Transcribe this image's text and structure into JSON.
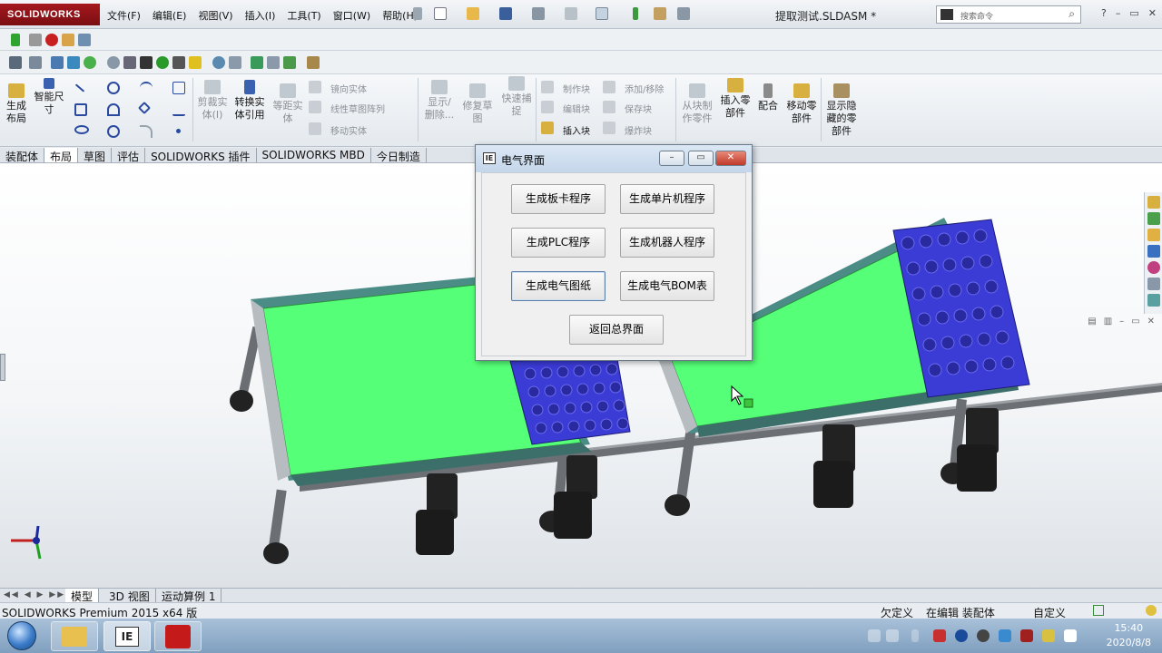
{
  "app": {
    "logo": "SOLIDWORKS",
    "document_title": "提取测试.SLDASM *",
    "menus": [
      "文件(F)",
      "编辑(E)",
      "视图(V)",
      "插入(I)",
      "工具(T)",
      "窗口(W)",
      "帮助(H)"
    ],
    "search_placeholder": "搜索命令",
    "window_controls": [
      "?",
      "–",
      "▭",
      "✕"
    ]
  },
  "ribbon": {
    "generate_layout": "生成\n布局",
    "smart_dimension": "智能尺\n寸",
    "trim_entities": "剪裁实\n体(I)",
    "convert_entities": "转换实\n体引用",
    "offset_entities": "等距实\n体",
    "mirror_entities": "镜向实体",
    "linear_pattern": "线性草图阵列",
    "move_entities": "移动实体",
    "show_delete": "显示/\n删除...",
    "repair_sketch": "修复草\n图",
    "quick_snap": "快速捕\n捉",
    "make_block": "制作块",
    "edit_block": "编辑块",
    "insert_block": "插入块",
    "add_remove": "添加/移除",
    "save_block": "保存块",
    "explode_block": "爆炸块",
    "make_part_from_block": "从块制\n作零件",
    "insert_component": "插入零\n部件",
    "mate": "配合",
    "move_component": "移动零\n部件",
    "show_hidden": "显示隐\n藏的零\n部件"
  },
  "tabs": [
    {
      "label": "装配体",
      "active": false
    },
    {
      "label": "布局",
      "active": true
    },
    {
      "label": "草图",
      "active": false
    },
    {
      "label": "评估",
      "active": false
    },
    {
      "label": "SOLIDWORKS 插件",
      "active": false
    },
    {
      "label": "SOLIDWORKS MBD",
      "active": false
    },
    {
      "label": "今日制造",
      "active": false
    }
  ],
  "dialog": {
    "title": "电气界面",
    "app_icon_text": "IE",
    "buttons": {
      "board_card": "生成板卡程序",
      "mcu": "生成单片机程序",
      "plc": "生成PLC程序",
      "robot": "生成机器人程序",
      "drawing": "生成电气图纸",
      "bom": "生成电气BOM表",
      "back": "返回总界面"
    },
    "controls": {
      "minimize": "–",
      "maximize": "▭",
      "close": "✕"
    }
  },
  "view_tabs": {
    "nav": "◀◀ ◀ ▶ ▶▶",
    "model": "模型",
    "view3d": "3D 视图",
    "motion": "运动算例 1"
  },
  "status": {
    "product": "SOLIDWORKS Premium 2015 x64 版",
    "underdefined": "欠定义",
    "editing": "在编辑 装配体",
    "custom": "自定义"
  },
  "taskbar": {
    "time": "15:40",
    "date": "2020/8/8",
    "app_label": "IE"
  },
  "colors": {
    "conveyor_belt": "#55ff77",
    "blue_pallet": "#3b3bd6",
    "solidworks_red": "#a5181e",
    "dialog_close": "#c0392b"
  }
}
